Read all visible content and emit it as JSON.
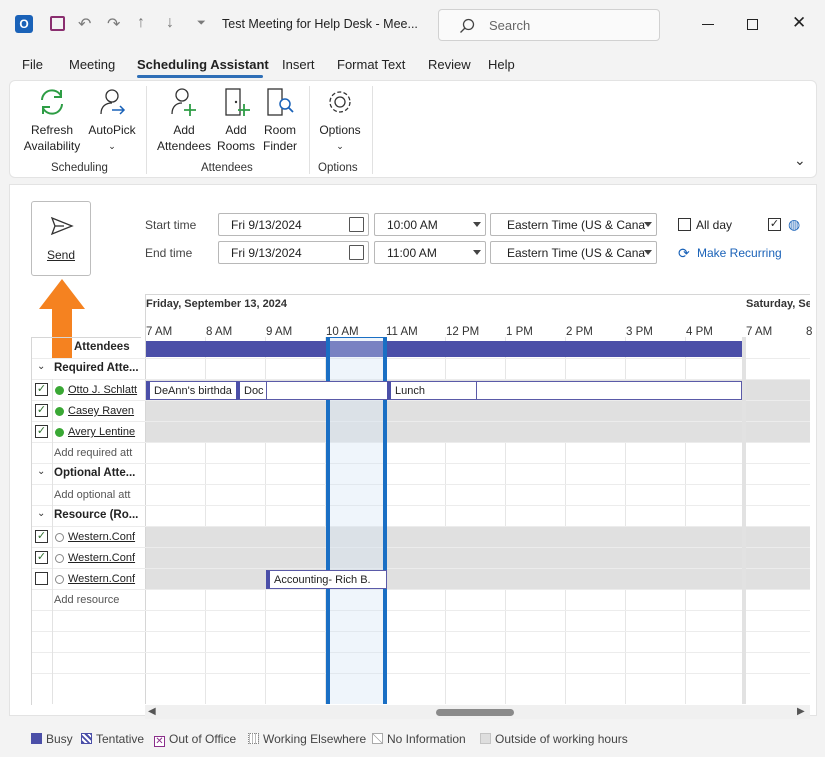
{
  "window": {
    "title": "Test Meeting for Help Desk  -  Mee...",
    "search_placeholder": "Search"
  },
  "menu": [
    "File",
    "Meeting",
    "Scheduling Assistant",
    "Insert",
    "Format Text",
    "Review",
    "Help"
  ],
  "ribbon": {
    "refresh": [
      "Refresh",
      "Availability"
    ],
    "autopick": "AutoPick",
    "add_attendees": [
      "Add",
      "Attendees"
    ],
    "add_rooms": [
      "Add",
      "Rooms"
    ],
    "room_finder": [
      "Room",
      "Finder"
    ],
    "options": "Options",
    "groups": [
      "Scheduling",
      "Attendees",
      "Options"
    ]
  },
  "send_label": "Send",
  "times": {
    "start_label": "Start time",
    "end_label": "End time",
    "start_date": "Fri 9/13/2024",
    "start_time": "10:00 AM",
    "end_date": "Fri 9/13/2024",
    "end_time": "11:00 AM",
    "timezone": "Eastern Time (US & Cana",
    "all_day": "All day",
    "make_recurring": "Make Recurring"
  },
  "day_header": "Friday, September 13, 2024",
  "next_day_header": "Saturday, Se",
  "hours": [
    "7 AM",
    "8 AM",
    "9 AM",
    "10 AM",
    "11 AM",
    "12 PM",
    "1 PM",
    "2 PM",
    "3 PM",
    "4 PM"
  ],
  "next_hours": [
    "7 AM",
    "8"
  ],
  "attendees_header": "Attendees",
  "sections": {
    "required": "Required Atte...",
    "optional": "Optional Atte...",
    "resource": "Resource (Ro..."
  },
  "required": [
    "Otto J. Schlatt",
    "Casey Raven",
    "Avery Lentine"
  ],
  "add_required": "Add required att",
  "add_optional": "Add optional att",
  "resources": [
    "Western.Conf",
    "Western.Conf",
    "Western.Conf"
  ],
  "add_resource": "Add resource",
  "events": {
    "birthday": "DeAnn's birthda",
    "doc": "Doc",
    "lunch": "Lunch",
    "accounting": "Accounting- Rich B."
  },
  "legend": [
    "Busy",
    "Tentative",
    "Out of Office",
    "Working Elsewhere",
    "No Information",
    "Outside of working hours"
  ],
  "colors": {
    "accent": "#2f6fb7",
    "busy": "#4b4fa8",
    "selection": "#1a6fc4",
    "arrow": "#f58220",
    "green": "#3aa835"
  }
}
